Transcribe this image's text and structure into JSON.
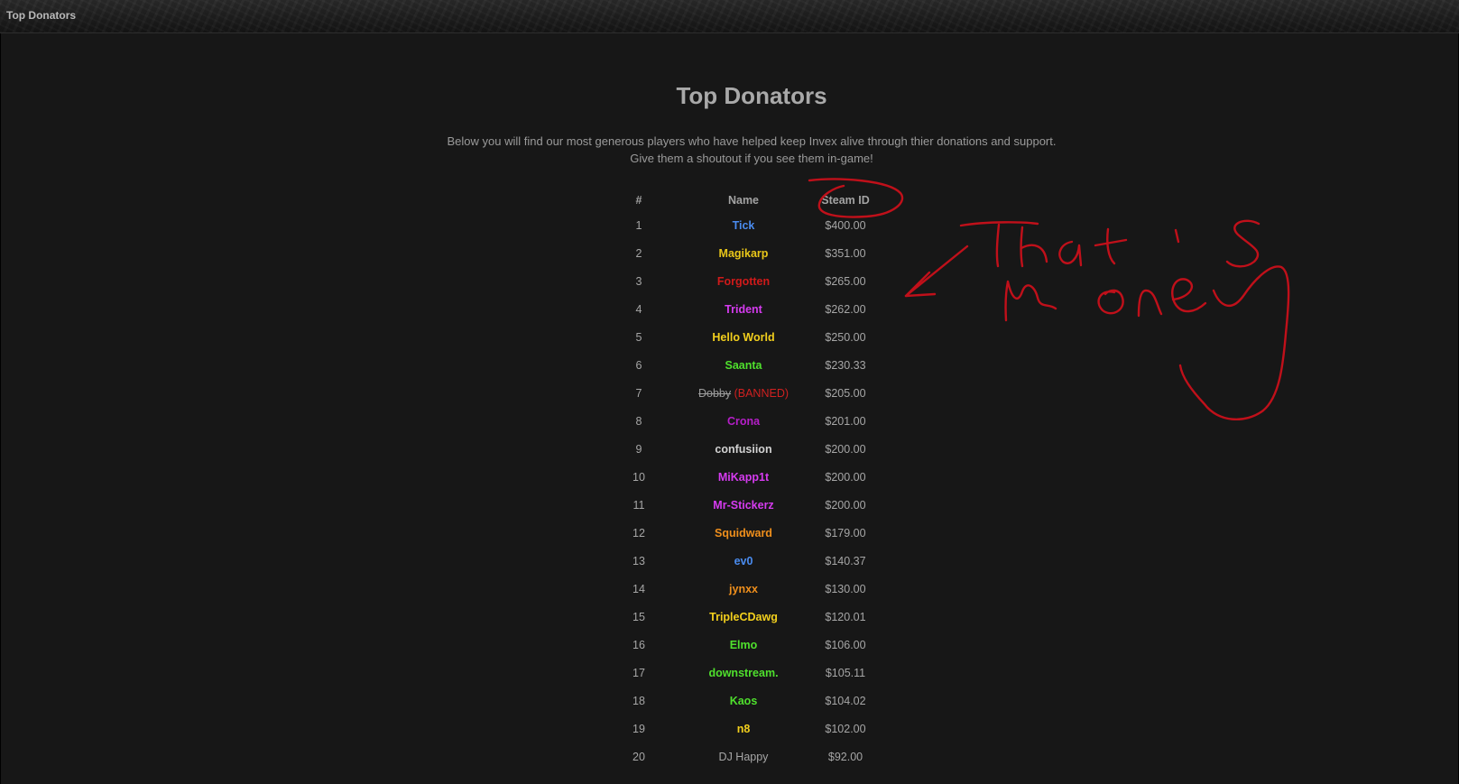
{
  "header": {
    "title": "Top Donators"
  },
  "page": {
    "title": "Top Donators",
    "intro_line1": "Below you will find our most generous players who have helped keep Invex alive through thier donations and support.",
    "intro_line2": "Give them a shoutout if you see them in-game!"
  },
  "table": {
    "headers": {
      "rank": "#",
      "name": "Name",
      "amount": "Steam ID"
    },
    "rows": [
      {
        "rank": "1",
        "name": "Tick",
        "amount": "$400.00",
        "color": "#4a8cf0"
      },
      {
        "rank": "2",
        "name": "Magikarp",
        "amount": "$351.00",
        "color": "#e8c619"
      },
      {
        "rank": "3",
        "name": "Forgotten",
        "amount": "$265.00",
        "color": "#d01a1a"
      },
      {
        "rank": "4",
        "name": "Trident",
        "amount": "$262.00",
        "color": "#d63bf0"
      },
      {
        "rank": "5",
        "name": "Hello World",
        "amount": "$250.00",
        "color": "#f2cf1d"
      },
      {
        "rank": "6",
        "name": "Saanta",
        "amount": "$230.33",
        "color": "#4fe02d"
      },
      {
        "rank": "7",
        "name": "Dobby",
        "amount": "$205.00",
        "status": "(BANNED)"
      },
      {
        "rank": "8",
        "name": "Crona",
        "amount": "$201.00",
        "color": "#b51ec8"
      },
      {
        "rank": "9",
        "name": "confusiion",
        "amount": "$200.00",
        "color": "#d2d2d2"
      },
      {
        "rank": "10",
        "name": "MiKapp1t",
        "amount": "$200.00",
        "color": "#d63bf0"
      },
      {
        "rank": "11",
        "name": "Mr-Stickerz",
        "amount": "$200.00",
        "color": "#d63bf0"
      },
      {
        "rank": "12",
        "name": "Squidward",
        "amount": "$179.00",
        "color": "#ef8f1c"
      },
      {
        "rank": "13",
        "name": "ev0",
        "amount": "$140.37",
        "color": "#4a8cf0"
      },
      {
        "rank": "14",
        "name": "jynxx",
        "amount": "$130.00",
        "color": "#ef8f1c"
      },
      {
        "rank": "15",
        "name": "TripleCDawg",
        "amount": "$120.01",
        "color": "#f2cf1d"
      },
      {
        "rank": "16",
        "name": "Elmo",
        "amount": "$106.00",
        "color": "#4fe02d"
      },
      {
        "rank": "17",
        "name": "downstream.",
        "amount": "$105.11",
        "color": "#4fe02d"
      },
      {
        "rank": "18",
        "name": "Kaos",
        "amount": "$104.02",
        "color": "#4fe02d"
      },
      {
        "rank": "19",
        "name": "n8",
        "amount": "$102.00",
        "color": "#f2cf1d"
      },
      {
        "rank": "20",
        "name": "DJ Happy",
        "amount": "$92.00",
        "color": "#a6a6a6",
        "plain": true
      }
    ]
  },
  "annotation": {
    "color": "#c0101a",
    "icon": "handwritten-scribble"
  }
}
